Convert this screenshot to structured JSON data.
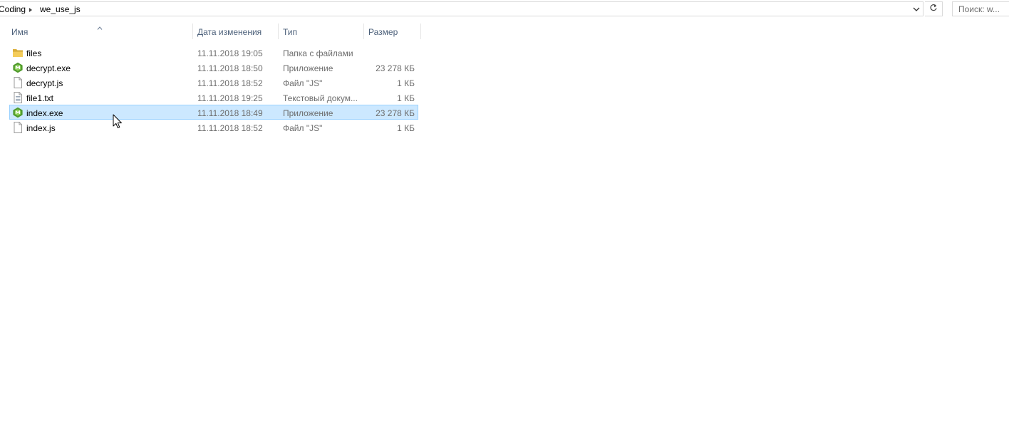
{
  "address_bar": {
    "crumbs": [
      {
        "label": "Coding"
      },
      {
        "label": "we_use_js"
      }
    ]
  },
  "search": {
    "placeholder": "Поиск: w..."
  },
  "columns": {
    "name": "Имя",
    "date": "Дата изменения",
    "type": "Тип",
    "size": "Размер"
  },
  "files": [
    {
      "name": "files",
      "date": "11.11.2018 19:05",
      "type": "Папка с файлами",
      "size": "",
      "icon": "folder-icon",
      "selected": false
    },
    {
      "name": "decrypt.exe",
      "date": "11.11.2018 18:50",
      "type": "Приложение",
      "size": "23 278 КБ",
      "icon": "exe-app-icon",
      "selected": false
    },
    {
      "name": "decrypt.js",
      "date": "11.11.2018 18:52",
      "type": "Файл \"JS\"",
      "size": "1 КБ",
      "icon": "js-file-icon",
      "selected": false
    },
    {
      "name": "file1.txt",
      "date": "11.11.2018 19:25",
      "type": "Текстовый докум...",
      "size": "1 КБ",
      "icon": "text-file-icon",
      "selected": false
    },
    {
      "name": "index.exe",
      "date": "11.11.2018 18:49",
      "type": "Приложение",
      "size": "23 278 КБ",
      "icon": "exe-app-icon",
      "selected": true
    },
    {
      "name": "index.js",
      "date": "11.11.2018 18:52",
      "type": "Файл \"JS\"",
      "size": "1 КБ",
      "icon": "js-file-icon",
      "selected": false
    }
  ],
  "colors": {
    "selection_bg": "#cce8ff",
    "selection_border": "#99d1ff",
    "header_text": "#4c607a",
    "secondary_text": "#6d6d6d"
  }
}
